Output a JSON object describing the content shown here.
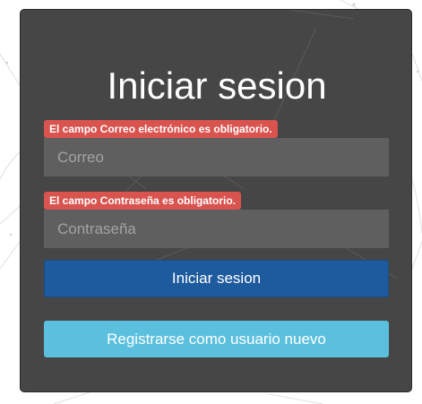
{
  "login": {
    "title": "Iniciar sesion",
    "email": {
      "error": "El campo Correo electrónico es obligatorio.",
      "placeholder": "Correo",
      "value": ""
    },
    "password": {
      "error": "El campo Contraseña es obligatorio.",
      "placeholder": "Contraseña",
      "value": ""
    },
    "submit_label": "Iniciar sesion",
    "register_label": "Registrarse como usuario nuevo"
  },
  "colors": {
    "card_background": "#404040",
    "error_badge": "#d9534f",
    "input_background": "#5f5f5f",
    "primary_button": "#1e5b9e",
    "info_button": "#5bc0de"
  }
}
